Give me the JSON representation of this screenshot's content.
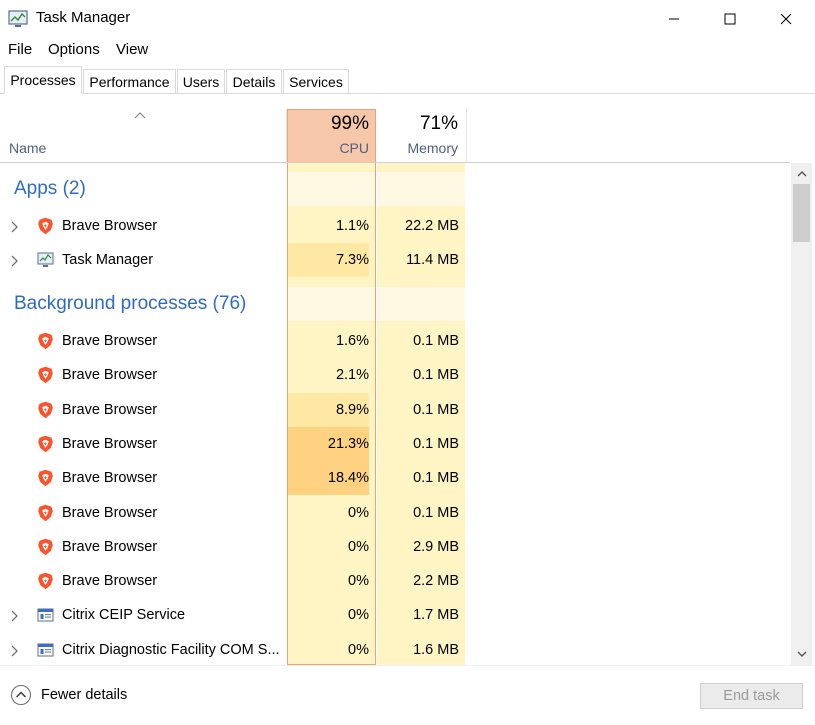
{
  "window": {
    "title": "Task Manager"
  },
  "menu": {
    "file": "File",
    "options": "Options",
    "view": "View"
  },
  "tabs": [
    {
      "label": "Processes",
      "active": true
    },
    {
      "label": "Performance"
    },
    {
      "label": "Users"
    },
    {
      "label": "Details"
    },
    {
      "label": "Services"
    }
  ],
  "columns": {
    "name": "Name",
    "cpu": {
      "percent": "99%",
      "label": "CPU"
    },
    "memory": {
      "percent": "71%",
      "label": "Memory"
    }
  },
  "sections": {
    "apps": "Apps (2)",
    "background": "Background processes (76)"
  },
  "apps": [
    {
      "name": "Brave Browser",
      "icon": "brave-icon",
      "cpu": "1.1%",
      "memory": "22.2 MB",
      "expandable": true
    },
    {
      "name": "Task Manager",
      "icon": "task-manager-icon",
      "cpu": "7.3%",
      "memory": "11.4 MB",
      "expandable": true
    }
  ],
  "background": [
    {
      "name": "Brave Browser",
      "icon": "brave-icon",
      "cpu": "1.6%",
      "memory": "0.1 MB"
    },
    {
      "name": "Brave Browser",
      "icon": "brave-icon",
      "cpu": "2.1%",
      "memory": "0.1 MB"
    },
    {
      "name": "Brave Browser",
      "icon": "brave-icon",
      "cpu": "8.9%",
      "memory": "0.1 MB"
    },
    {
      "name": "Brave Browser",
      "icon": "brave-icon",
      "cpu": "21.3%",
      "memory": "0.1 MB"
    },
    {
      "name": "Brave Browser",
      "icon": "brave-icon",
      "cpu": "18.4%",
      "memory": "0.1 MB"
    },
    {
      "name": "Brave Browser",
      "icon": "brave-icon",
      "cpu": "0%",
      "memory": "0.1 MB"
    },
    {
      "name": "Brave Browser",
      "icon": "brave-icon",
      "cpu": "0%",
      "memory": "2.9 MB"
    },
    {
      "name": "Brave Browser",
      "icon": "brave-icon",
      "cpu": "0%",
      "memory": "2.2 MB"
    },
    {
      "name": "Citrix CEIP Service",
      "icon": "service-icon",
      "cpu": "0%",
      "memory": "1.7 MB",
      "expandable": true
    },
    {
      "name": "Citrix Diagnostic Facility COM S...",
      "icon": "service-icon",
      "cpu": "0%",
      "memory": "1.6 MB",
      "expandable": true
    }
  ],
  "footer": {
    "fewer_details": "Fewer details",
    "end_task": "End task"
  },
  "colors": {
    "section_text": "#2f6cbf",
    "heat_low": "#fff4c4",
    "heat_mid": "#fee8a3",
    "heat_high": "#ffd282",
    "cpu_header": "#f7c7a9"
  }
}
